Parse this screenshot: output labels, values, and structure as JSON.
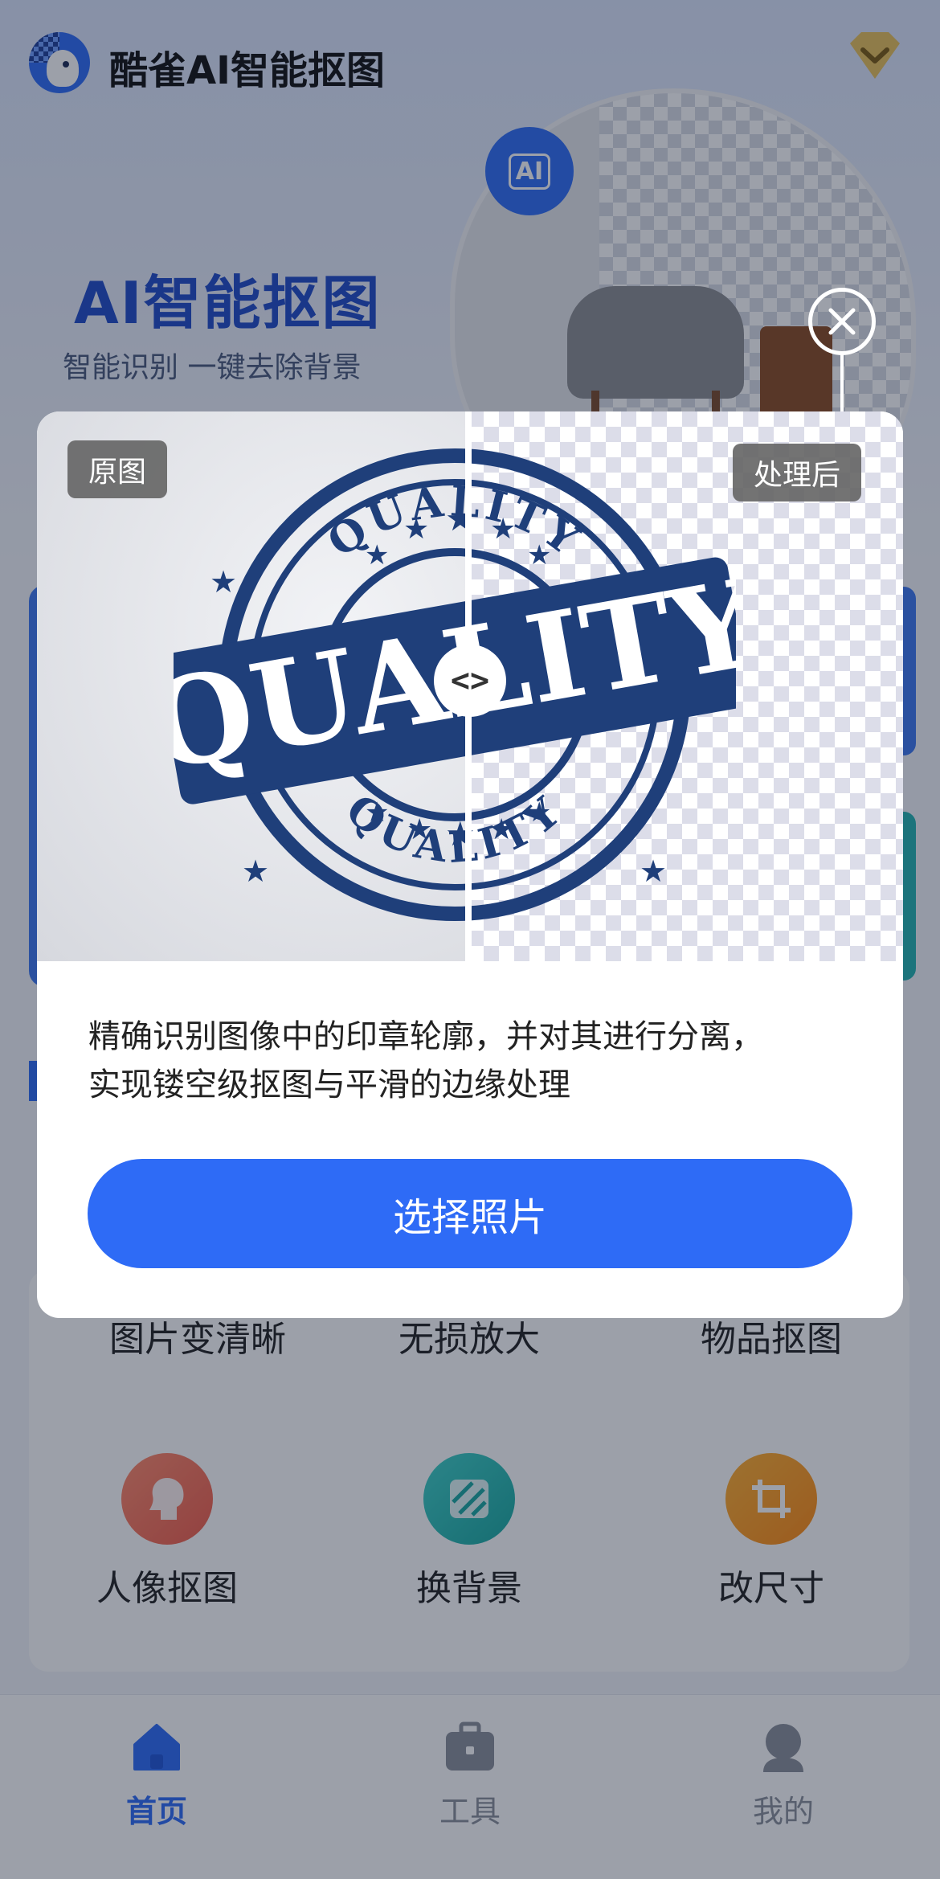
{
  "app": {
    "title": "酷雀AI智能抠图"
  },
  "hero": {
    "title": "AI智能抠图",
    "subtitle": "智能识别  一键去除背景",
    "badge_text": "AI"
  },
  "tools": [
    {
      "label": "图片变清晰",
      "icon": "sharpen-icon"
    },
    {
      "label": "无损放大",
      "icon": "upscale-icon"
    },
    {
      "label": "物品抠图",
      "icon": "object-cutout-icon"
    },
    {
      "label": "人像抠图",
      "icon": "portrait-icon"
    },
    {
      "label": "换背景",
      "icon": "background-icon"
    },
    {
      "label": "改尺寸",
      "icon": "resize-icon"
    }
  ],
  "nav": [
    {
      "label": "首页",
      "icon": "home-icon",
      "active": true
    },
    {
      "label": "工具",
      "icon": "toolbox-icon",
      "active": false
    },
    {
      "label": "我的",
      "icon": "profile-icon",
      "active": false
    }
  ],
  "modal": {
    "before_label": "原图",
    "after_label": "处理后",
    "stamp_text": "QUALITY",
    "description_line1": "精确识别图像中的印章轮廓，并对其进行分离，",
    "description_line2": "实现镂空级抠图与平滑的边缘处理",
    "cta_label": "选择照片",
    "handle_glyph": "<>"
  },
  "colors": {
    "accent": "#2e6bf6",
    "stamp_blue": "#1f3f7a",
    "overlay": "rgba(20,28,50,0.42)"
  }
}
